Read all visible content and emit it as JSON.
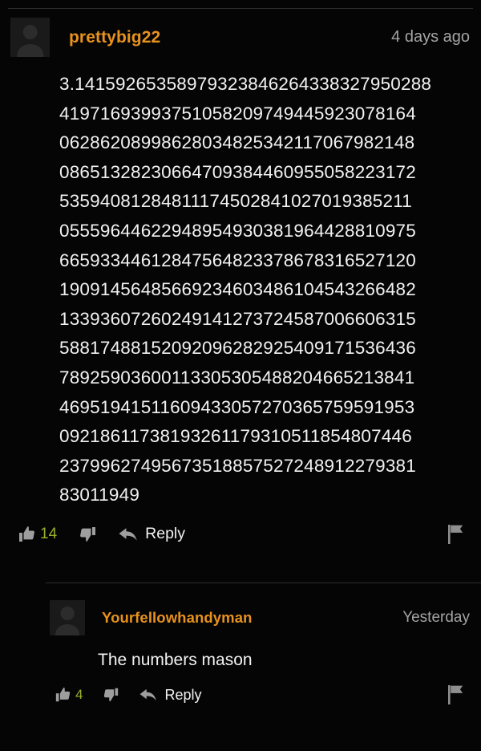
{
  "theme": {
    "background": "#050505",
    "username_color": "#e8921e",
    "timestamp_color": "#a3a3a3",
    "body_text_color": "#f2f2f2",
    "vote_count_color": "#9aae2a",
    "icon_color": "#9e9e9e",
    "divider_color": "#2e2e2e"
  },
  "comments": [
    {
      "id": "root-comment",
      "avatar_icon": "default-user-avatar-icon",
      "username": "prettybig22",
      "timestamp": "4 days ago",
      "body": "3.14159265358979323846264338327950288419716939937510582097494459230781640628620899862803482534211706798214808651328230664709384460955058223172535940812848111745028410270193852110555964462294895493038196442881097566593344612847564823378678316527120190914564856692346034861045432664821339360726024914127372458700660631558817488152092096282925409171536436789259036001133053054882046652138414695194151160943305727036575959195309218611738193261179310511854807446237996274956735188575272489122793818301194 9",
      "body_lines": [
        "3.14159265358979323846264338327950288",
        "41971693993751058209749445923078164",
        "06286208998628034825342117067982148",
        "08651328230664709384460955058223172",
        "53594081284811174502841027019385211",
        "05559644622948954930381964428810975",
        "66593344612847564823378678316527120",
        "19091456485669234603486104543266482",
        "13393607260249141273724587006606315",
        "58817488152092096282925409171536436",
        "78925903600113305305488204665213841",
        "46951941511609433057270365759591953",
        "09218611738193261179310511854807446",
        "23799627495673518857527248912279381",
        "83011949"
      ],
      "actions": {
        "upvote_icon": "thumbs-up-icon",
        "upvote_count": "14",
        "downvote_icon": "thumbs-down-icon",
        "reply_icon": "reply-arrow-icon",
        "reply_label": "Reply",
        "flag_icon": "flag-icon"
      }
    },
    {
      "id": "reply-comment",
      "avatar_icon": "default-user-avatar-icon",
      "username": "Yourfellowhandyman",
      "timestamp": "Yesterday",
      "body": "The numbers mason",
      "actions": {
        "upvote_icon": "thumbs-up-icon",
        "upvote_count": "4",
        "downvote_icon": "thumbs-down-icon",
        "reply_icon": "reply-arrow-icon",
        "reply_label": "Reply",
        "flag_icon": "flag-icon"
      }
    }
  ]
}
